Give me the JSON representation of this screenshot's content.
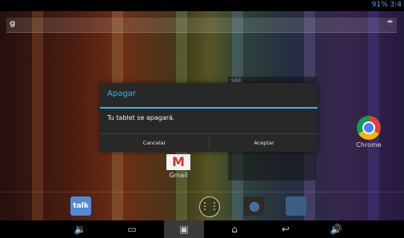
{
  "status_bar": {
    "text": "91% 3:4"
  },
  "search": {
    "google_glyph": "g",
    "mic_glyph": "☂"
  },
  "widget": {
    "label": "SÁB"
  },
  "desktop_apps": [
    {
      "label": "Chrome",
      "icon": "chrome-icon"
    },
    {
      "label": "Gmail",
      "icon": "gmail-icon"
    }
  ],
  "dock": {
    "talk_label": "talk",
    "allapps_glyph": "⋮⋮"
  },
  "dialog": {
    "title": "Apagar",
    "message": "Tu tablet se apagará.",
    "cancel": "Cancelar",
    "accept": "Aceptar",
    "accent_color": "#33b5e5"
  },
  "nav": {
    "vol_down": "🔉",
    "recents": "▭",
    "screenshot": "▣",
    "home": "⌂",
    "back": "↩",
    "vol_up": "🔊"
  }
}
